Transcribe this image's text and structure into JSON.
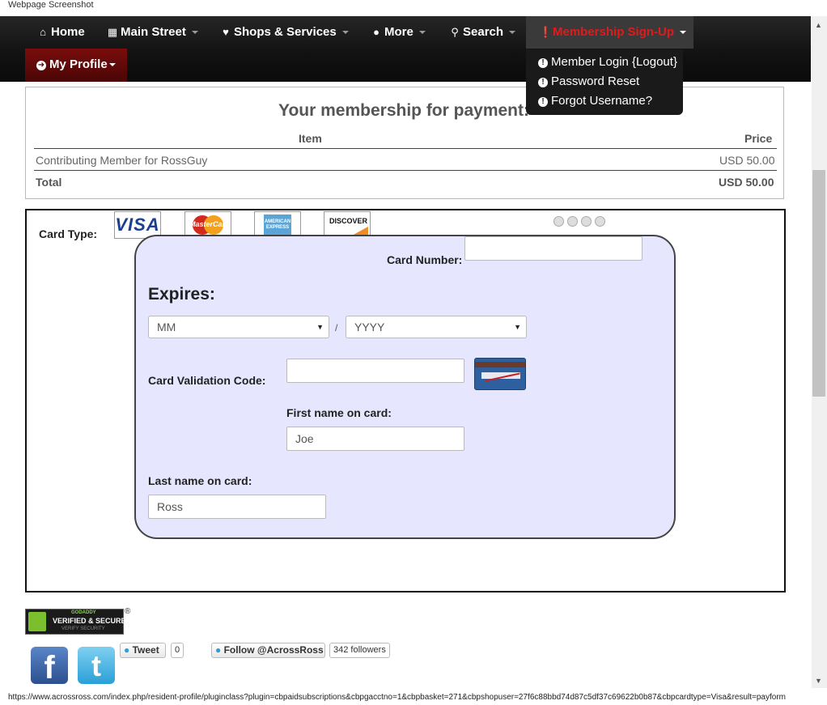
{
  "window": {
    "caption": "Webpage Screenshot"
  },
  "nav": {
    "home": "Home",
    "main_street": "Main Street",
    "shops": "Shops & Services",
    "more": "More",
    "search": "Search",
    "membership": "Membership Sign-Up",
    "my_profile": "My Profile"
  },
  "dropdown": {
    "items": [
      "Member Login {Logout}",
      "Password Reset",
      "Forgot Username?"
    ]
  },
  "membership": {
    "title": "Your membership for payment:",
    "col_item": "Item",
    "col_price": "Price",
    "row_item": "Contributing Member for RossGuy",
    "row_price": "USD 50.00",
    "total_label": "Total",
    "total_value": "USD 50.00"
  },
  "payment": {
    "card_type_label": "Card Type:",
    "cards": [
      "VISA",
      "MasterCard",
      "AMERICAN EXPRESS",
      "DISCOVER"
    ],
    "card_number_label": "Card Number:",
    "card_number_value": "",
    "expires_label": "Expires:",
    "month_selected": "MM",
    "separator": "/",
    "year_selected": "YYYY",
    "cvc_label": "Card Validation Code:",
    "cvc_value": "",
    "first_name_label": "First name on card:",
    "first_name_value": "Joe",
    "last_name_label": "Last name on card:",
    "last_name_value": "Ross"
  },
  "footer": {
    "badge_top": "GODADDY",
    "badge_main": "VERIFIED & SECURED",
    "badge_sub": "VERIFY SECURITY",
    "badge_reg": "®",
    "tweet": "Tweet",
    "tweet_count": "0",
    "follow": "Follow @AcrossRoss",
    "followers": "342 followers"
  },
  "status_url": "https://www.acrossross.com/index.php/resident-profile/pluginclass?plugin=cbpaidsubscriptions&cbpgacctno=1&cbpbasket=271&cbpshopuser=27f6c88bbd74d87c5df37c69622b0b87&cbpcardtype=Visa&result=payform",
  "colors": {
    "nav_bg": "#111111",
    "member_red": "#e01b1b",
    "form_bg": "#e6e6ff"
  }
}
